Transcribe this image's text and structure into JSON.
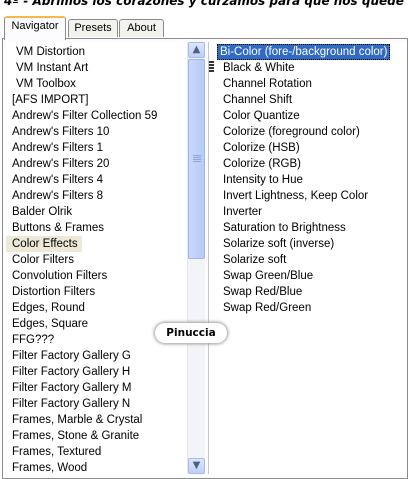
{
  "header_text": "4º - Abrimos los corazones y curzamos para que nos quede",
  "tabs": [
    {
      "label": "Navigator",
      "active": true
    },
    {
      "label": "Presets",
      "active": false
    },
    {
      "label": "About",
      "active": false
    }
  ],
  "filter_categories": [
    "VM Distortion",
    "VM Instant Art",
    "VM Toolbox",
    "[AFS IMPORT]",
    "Andrew's Filter Collection 59",
    "Andrew's Filters 10",
    "Andrew's Filters 1",
    "Andrew's Filters 20",
    "Andrew's Filters 4",
    "Andrew's Filters 8",
    "Balder Olrik",
    "Buttons & Frames",
    "Color Effects",
    "Color Filters",
    "Convolution Filters",
    "Distortion Filters",
    "Edges, Round",
    "Edges, Square",
    "FFG???",
    "Filter Factory Gallery G",
    "Filter Factory Gallery H",
    "Filter Factory Gallery M",
    "Filter Factory Gallery N",
    "Frames, Marble & Crystal",
    "Frames, Stone & Granite",
    "Frames, Textured",
    "Frames, Wood"
  ],
  "selected_category": "Color Effects",
  "filters": [
    "Bi-Color (fore-/background color)",
    "Black & White",
    "Channel Rotation",
    "Channel Shift",
    "Color Quantize",
    "Colorize (foreground color)",
    "Colorize (HSB)",
    "Colorize (RGB)",
    "Intensity to Hue",
    "Invert Lightness, Keep Color",
    "Inverter",
    "Saturation to Brightness",
    "Solarize soft (inverse)",
    "Solarize soft",
    "Swap Green/Blue",
    "Swap Red/Blue",
    "Swap Red/Green"
  ],
  "selected_filter": "Bi-Color (fore-/background color)",
  "watermark_text": "Pinuccia",
  "icons": {
    "scroll_up": "scroll-up-arrow-icon",
    "scroll_down": "scroll-down-arrow-icon"
  },
  "colors": {
    "selection": "#316ac5",
    "tab_accent": "#f9b64c",
    "category_highlight": "#ece9d8"
  }
}
